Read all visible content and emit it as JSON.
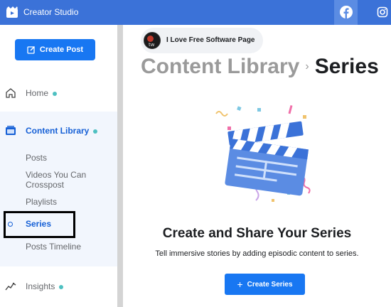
{
  "app": {
    "title": "Creator Studio"
  },
  "topbar": {
    "platforms": [
      "facebook-icon",
      "instagram-icon"
    ],
    "brand_color": "#3b72d8"
  },
  "sidebar": {
    "create_post_label": "Create Post",
    "items": [
      {
        "label": "Home",
        "icon": "home-icon"
      },
      {
        "label": "Content Library",
        "icon": "content-library-icon",
        "active": true
      },
      {
        "label": "Insights",
        "icon": "insights-icon"
      }
    ],
    "sub_items": [
      {
        "label": "Posts"
      },
      {
        "label": "Videos You Can Crosspost"
      },
      {
        "label": "Playlists"
      },
      {
        "label": "Series",
        "active": true
      },
      {
        "label": "Posts Timeline"
      }
    ]
  },
  "page_selector": {
    "name": "I Love Free Software Page"
  },
  "breadcrumb": {
    "parent": "Content Library",
    "current": "Series"
  },
  "empty_state": {
    "title": "Create and Share Your Series",
    "description": "Tell immersive stories by adding episodic content to series.",
    "button_label": "Create Series"
  },
  "colors": {
    "accent": "#1877f2",
    "active_text": "#1660d6",
    "status_dot": "#4ec0c1"
  }
}
